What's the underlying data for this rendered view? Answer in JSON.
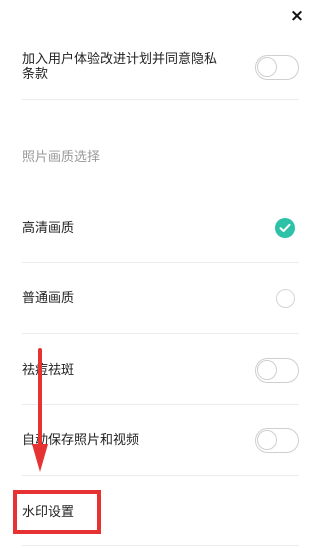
{
  "close": {
    "glyph": "×"
  },
  "settings": {
    "privacy_label": "加入用户体验改进计划并同意隐私\n条款",
    "privacy_on": false,
    "photo_quality_section": "照片画质选择",
    "quality_hd": {
      "label": "高清画质",
      "selected": true
    },
    "quality_normal": {
      "label": "普通画质",
      "selected": false
    },
    "blemish_label": "祛痘祛斑",
    "blemish_on": false,
    "autosave_label": "自动保存照片和视频",
    "autosave_on": false,
    "watermark_label": "水印设置"
  },
  "colors": {
    "accent": "#2dc2a8",
    "annotation": "#e63232",
    "divider": "#ececec"
  }
}
